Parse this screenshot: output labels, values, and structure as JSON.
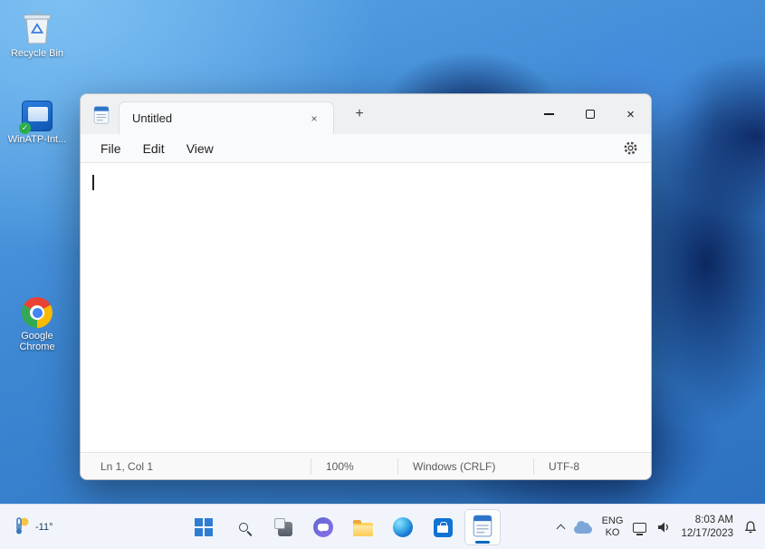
{
  "desktop": {
    "icons": [
      {
        "label": "Recycle Bin"
      },
      {
        "label": "WinATP-Int..."
      },
      {
        "label": "Google Chrome"
      }
    ]
  },
  "notepad": {
    "tab_title": "Untitled",
    "menus": [
      "File",
      "Edit",
      "View"
    ],
    "statusbar": {
      "cursor_position": "Ln 1, Col 1",
      "zoom_level": "100%",
      "line_ending": "Windows (CRLF)",
      "encoding": "UTF-8"
    }
  },
  "taskbar": {
    "weather": {
      "temperature": "-11°"
    },
    "tray": {
      "language_line1": "ENG",
      "language_line2": "KO",
      "time": "8:03 AM",
      "date": "12/17/2023"
    }
  },
  "icons": {
    "tab_close": "×",
    "new_tab": "+",
    "window_close": "×"
  },
  "colors": {
    "accent": "#0067c0",
    "taskbar_bg": "#f1f5fb"
  }
}
